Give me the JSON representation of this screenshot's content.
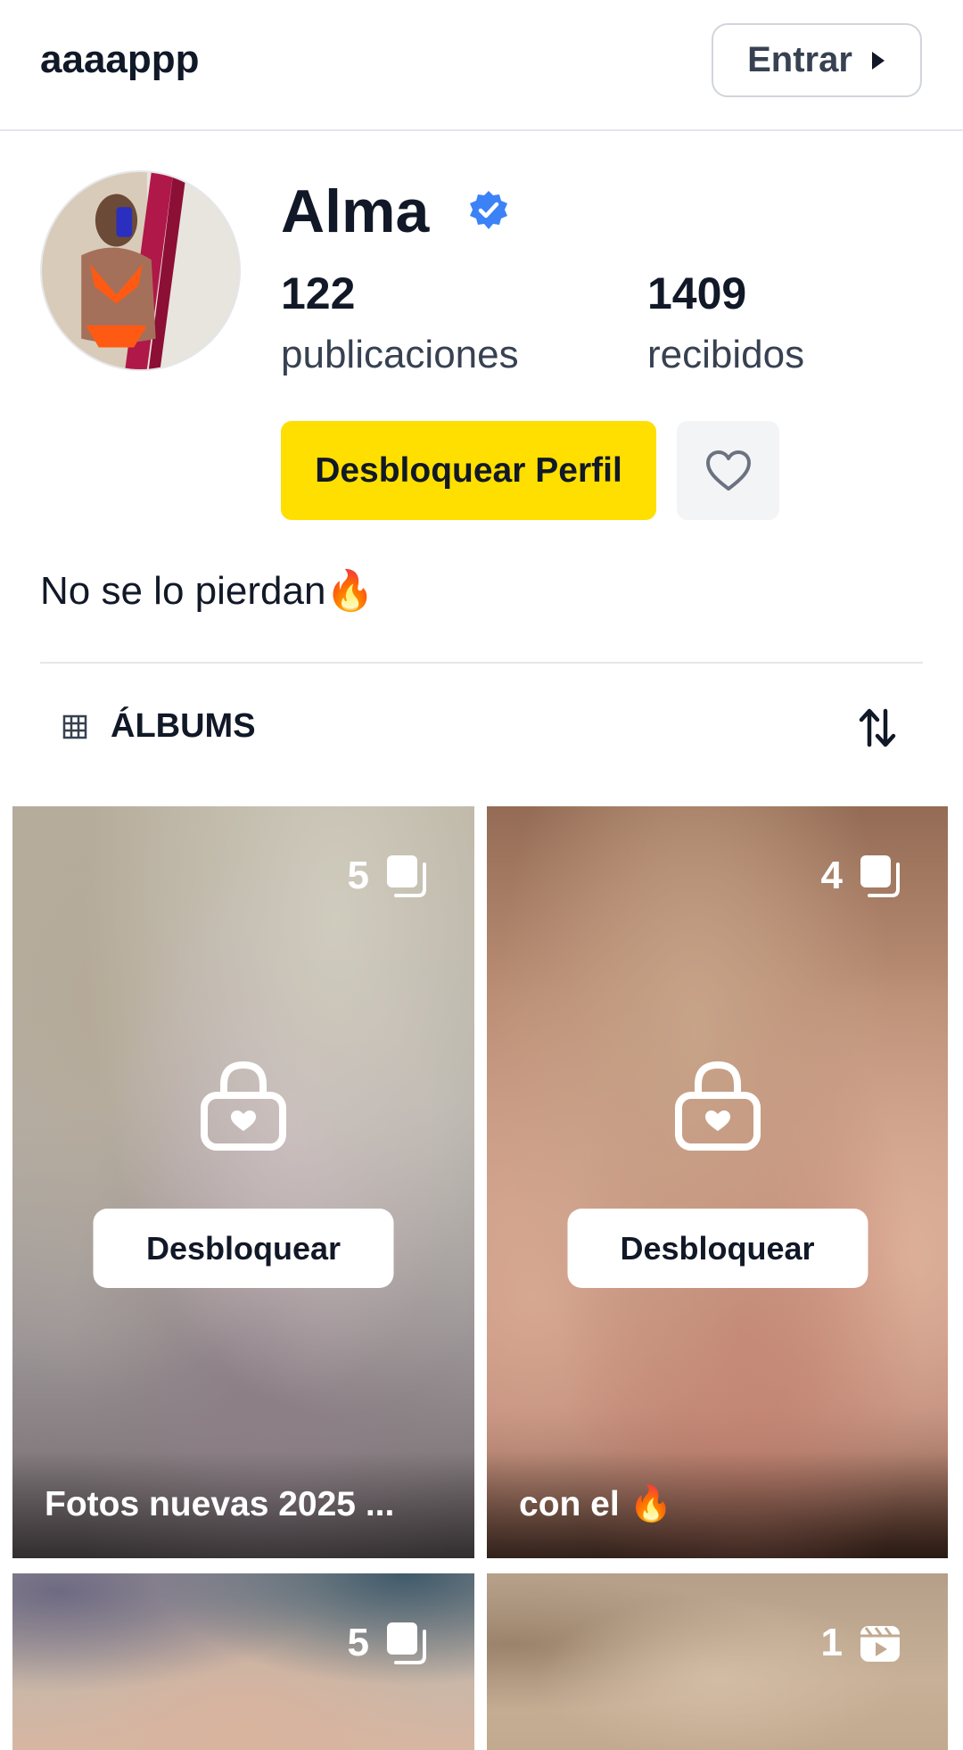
{
  "header": {
    "brand": "aaaappp",
    "login_label": "Entrar"
  },
  "profile": {
    "name": "Alma",
    "verified": true,
    "stats": [
      {
        "value": "122",
        "label": "publicaciones"
      },
      {
        "value": "1409",
        "label": "recibidos"
      }
    ],
    "unlock_label": "Desbloquear Perfil",
    "bio": "No se lo pierdan🔥"
  },
  "tabs": {
    "albums_label": "ÁLBUMS"
  },
  "albums": [
    {
      "count": "5",
      "type_icon": "stack-icon",
      "unlock_label": "Desbloquear",
      "caption": "Fotos nuevas 2025 ..."
    },
    {
      "count": "4",
      "type_icon": "stack-icon",
      "unlock_label": "Desbloquear",
      "caption": "con el 🔥"
    },
    {
      "count": "5",
      "type_icon": "stack-icon"
    },
    {
      "count": "1",
      "type_icon": "video-clap-icon"
    }
  ],
  "colors": {
    "accent_yellow": "#fedf00",
    "verified_blue": "#3b82f6",
    "muted_bg": "#f3f4f6"
  }
}
